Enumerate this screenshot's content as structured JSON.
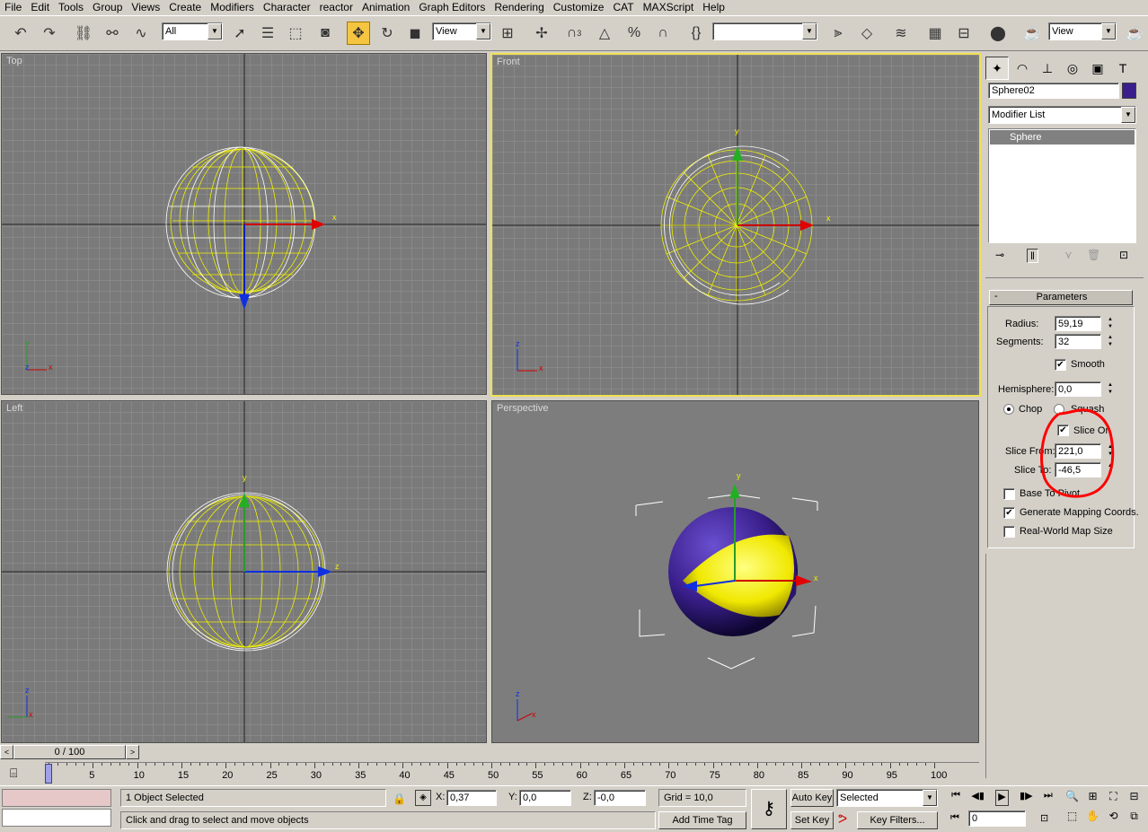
{
  "menu": [
    "File",
    "Edit",
    "Tools",
    "Group",
    "Views",
    "Create",
    "Modifiers",
    "Character",
    "reactor",
    "Animation",
    "Graph Editors",
    "Rendering",
    "Customize",
    "CAT",
    "MAXScript",
    "Help"
  ],
  "toolbar": {
    "selection_filter": "All",
    "ref_coord": "View",
    "named_selection": "",
    "render_type": "View",
    "snaps_label": "3"
  },
  "viewports": {
    "top": {
      "label": "Top"
    },
    "front": {
      "label": "Front"
    },
    "left": {
      "label": "Left"
    },
    "perspective": {
      "label": "Perspective"
    },
    "axis": {
      "x": "x",
      "y": "y",
      "z": "z"
    }
  },
  "command_panel": {
    "object_name": "Sphere02",
    "object_color": "#3a1f8c",
    "modifier_list": "Modifier List",
    "stack_item": "Sphere",
    "rollout_toggle": "-",
    "rollout_title": "Parameters",
    "params": {
      "radius_label": "Radius:",
      "radius": "59,19",
      "segments_label": "Segments:",
      "segments": "32",
      "smooth_label": "Smooth",
      "hemisphere_label": "Hemisphere:",
      "hemisphere": "0,0",
      "chop_label": "Chop",
      "squash_label": "Squash",
      "slice_on_label": "Slice On",
      "slice_from_label": "Slice From:",
      "slice_from": "221,0",
      "slice_to_label": "Slice To:",
      "slice_to": "-46,5",
      "base_to_pivot_label": "Base To Pivot",
      "gen_mapping_label": "Generate Mapping Coords.",
      "real_world_label": "Real-World Map Size"
    }
  },
  "timeline": {
    "slider_label": "0 / 100",
    "ticks": [
      "0",
      "5",
      "10",
      "15",
      "20",
      "25",
      "30",
      "35",
      "40",
      "45",
      "50",
      "55",
      "60",
      "65",
      "70",
      "75",
      "80",
      "85",
      "90",
      "95",
      "100"
    ]
  },
  "status": {
    "selection": "1 Object Selected",
    "prompt": "Click and drag to select and move objects",
    "x_label": "X:",
    "x": "0,37",
    "y_label": "Y:",
    "y": "0,0",
    "z_label": "Z:",
    "z": "-0,0",
    "grid": "Grid = 10,0",
    "add_time_tag": "Add Time Tag",
    "auto_key": "Auto Key",
    "set_key": "Set Key",
    "key_mode": "Selected",
    "key_filters": "Key Filters...",
    "frame": "0"
  },
  "colors": {
    "wire_yellow": "#f0f000",
    "sphere_purple": "#3a1f8c",
    "annotation_red": "#ff0000",
    "active_border": "#f0e050"
  }
}
